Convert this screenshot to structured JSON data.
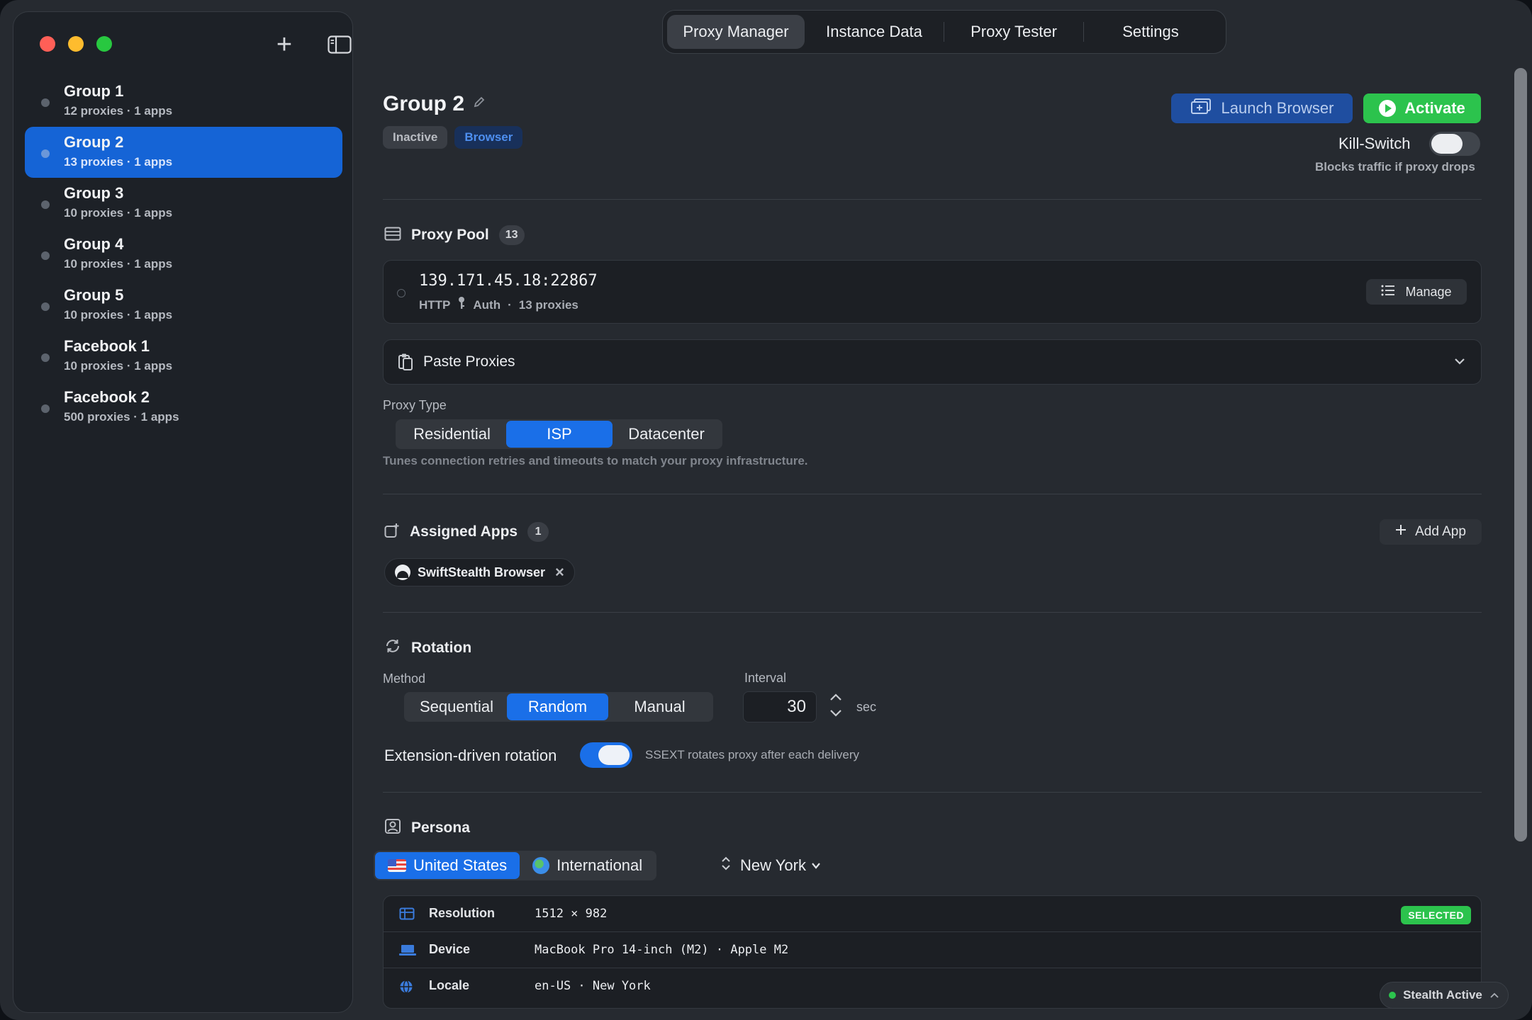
{
  "window": {
    "traffic_lights": [
      "close",
      "minimize",
      "zoom"
    ]
  },
  "sidebar": {
    "add_icon": "plus-icon",
    "toggle_icon": "sidebar-toggle-icon",
    "groups": [
      {
        "name": "Group 1",
        "meta": "12 proxies · 1 apps",
        "active": false
      },
      {
        "name": "Group 2",
        "meta": "13 proxies · 1 apps",
        "active": true
      },
      {
        "name": "Group 3",
        "meta": "10 proxies · 1 apps",
        "active": false
      },
      {
        "name": "Group 4",
        "meta": "10 proxies · 1 apps",
        "active": false
      },
      {
        "name": "Group 5",
        "meta": "10 proxies · 1 apps",
        "active": false
      },
      {
        "name": "Facebook 1",
        "meta": "10 proxies · 1 apps",
        "active": false
      },
      {
        "name": "Facebook 2",
        "meta": "500 proxies · 1 apps",
        "active": false
      }
    ]
  },
  "tabs": [
    {
      "label": "Proxy Manager",
      "active": true
    },
    {
      "label": "Instance Data",
      "active": false
    },
    {
      "label": "Proxy Tester",
      "active": false
    },
    {
      "label": "Settings",
      "active": false
    }
  ],
  "header": {
    "title": "Group 2",
    "status_badge": "Inactive",
    "type_badge": "Browser",
    "launch_label": "Launch Browser",
    "activate_label": "Activate",
    "kill_switch_label": "Kill-Switch",
    "kill_switch_on": false,
    "kill_switch_hint": "Blocks traffic if proxy drops"
  },
  "proxy_pool": {
    "title": "Proxy Pool",
    "count": "13",
    "address": "139.171.45.18:22867",
    "protocol": "HTTP",
    "auth": "Auth",
    "separator": "·",
    "proxies_count": "13 proxies",
    "manage_label": "Manage"
  },
  "paste_proxies": {
    "title": "Paste Proxies"
  },
  "proxy_type": {
    "label": "Proxy Type",
    "options": [
      "Residential",
      "ISP",
      "Datacenter"
    ],
    "selected": "ISP",
    "hint": "Tunes connection retries and timeouts to match your proxy infrastructure."
  },
  "assigned_apps": {
    "title": "Assigned Apps",
    "count": "1",
    "add_label": "Add App",
    "apps": [
      "SwiftStealth Browser"
    ]
  },
  "rotation": {
    "title": "Rotation",
    "method_label": "Method",
    "methods": [
      "Sequential",
      "Random",
      "Manual"
    ],
    "selected": "Random",
    "interval_label": "Interval",
    "interval_value": "30",
    "interval_unit": "sec",
    "extension_label": "Extension-driven rotation",
    "extension_on": true,
    "extension_hint": "SSEXT rotates proxy after each delivery"
  },
  "persona": {
    "title": "Persona",
    "regions": [
      "United States",
      "International"
    ],
    "selected_region": "United States",
    "city": "New York",
    "rows": [
      {
        "key": "Resolution",
        "value": "1512 × 982",
        "icon": "display-icon"
      },
      {
        "key": "Device",
        "value": "MacBook Pro 14-inch (M2) · Apple M2",
        "icon": "laptop-icon"
      },
      {
        "key": "Locale",
        "value": "en-US · New York",
        "icon": "globe-icon"
      }
    ],
    "selected_badge": "SELECTED"
  },
  "status": {
    "stealth_label": "Stealth Active"
  },
  "colors": {
    "accent": "#1a6fe8",
    "success": "#2cc34d",
    "background": "#262a30",
    "sidebar": "#1d2127"
  }
}
